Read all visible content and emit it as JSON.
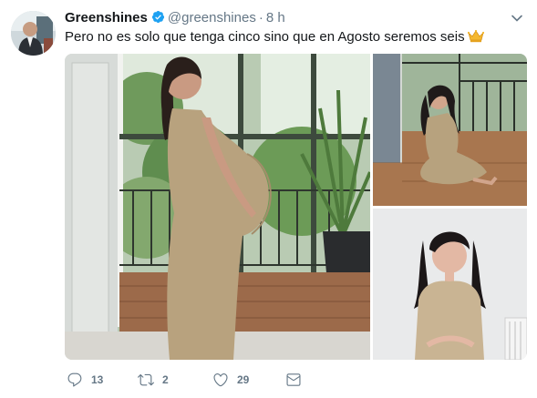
{
  "tweet": {
    "author_name": "Greenshines",
    "handle": "@greenshines",
    "separator": "·",
    "time": "8 h",
    "text": "Pero no es solo que tenga cinco sino que en Agosto seremos seis",
    "emoji": "crown-emoji",
    "verified_icon": "verified-badge-icon"
  },
  "media": {
    "photos": [
      {
        "subject": "woman-standing-profile-photo"
      },
      {
        "subject": "woman-sitting-floor-photo"
      },
      {
        "subject": "woman-portrait-photo"
      }
    ]
  },
  "actions": {
    "reply": {
      "icon": "reply-icon",
      "count": "13"
    },
    "retweet": {
      "icon": "retweet-icon",
      "count": "2"
    },
    "like": {
      "icon": "heart-icon",
      "count": "29"
    },
    "message": {
      "icon": "envelope-icon"
    }
  },
  "colors": {
    "accent": "#1da1f2",
    "secondary_text": "#657786",
    "primary_text": "#14171a"
  }
}
